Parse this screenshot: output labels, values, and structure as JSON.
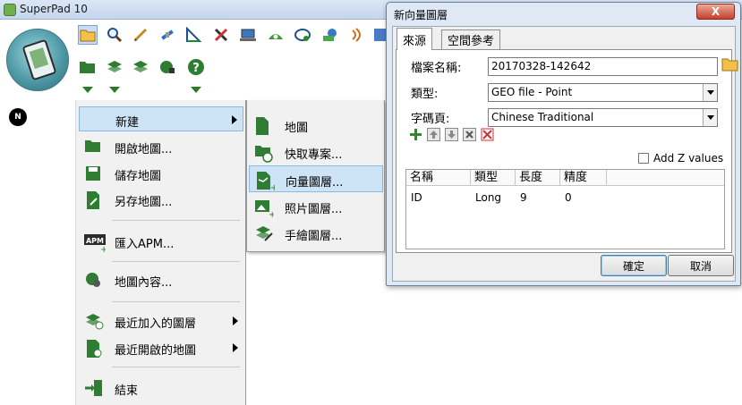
{
  "app": {
    "title": "SuperPad 10"
  },
  "toolbar": {
    "row1_icons": [
      "open-folder-icon",
      "zoom-icon",
      "pen-icon",
      "satellite-icon",
      "measure-icon",
      "tools-icon",
      "laptop-icon",
      "eye-map-icon",
      "cloud-sync-icon",
      "layers-globe-icon",
      "signal-icon",
      "grid-icon"
    ],
    "row2_icons": [
      "open-folder-icon",
      "layers-add-icon",
      "layers-icon",
      "globe-lock-icon",
      "help-icon"
    ]
  },
  "north_label": "N",
  "main_menu": {
    "items": [
      {
        "label": "新建",
        "icon": "new-icon",
        "submenu": true,
        "highlighted": true
      },
      {
        "label": "開啟地圖...",
        "icon": "folder-open-icon"
      },
      {
        "label": "儲存地圖",
        "icon": "save-icon"
      },
      {
        "label": "另存地圖...",
        "icon": "save-as-icon"
      },
      {
        "label": "匯入APM...",
        "icon": "apm-import-icon"
      },
      {
        "label": "地圖內容...",
        "icon": "map-properties-icon"
      },
      {
        "label": "最近加入的圖層",
        "icon": "recent-layers-icon",
        "submenu": true
      },
      {
        "label": "最近開啟的地圖",
        "icon": "recent-maps-icon",
        "submenu": true
      },
      {
        "label": "結束",
        "icon": "exit-icon"
      }
    ],
    "apm_icon_text": "APM"
  },
  "sub_menu": {
    "items": [
      {
        "label": "地圖",
        "icon": "map-doc-icon"
      },
      {
        "label": "快取專案...",
        "icon": "cache-project-icon"
      },
      {
        "label": "向量圖層...",
        "icon": "vector-layer-icon",
        "highlighted": true
      },
      {
        "label": "照片圖層...",
        "icon": "photo-layer-icon"
      },
      {
        "label": "手繪圖層...",
        "icon": "sketch-layer-icon"
      }
    ]
  },
  "dialog": {
    "title": "新向量圖層",
    "close_symbol": "X",
    "tabs": [
      "來源",
      "空間參考"
    ],
    "file_name_label": "檔案名稱:",
    "file_name_value": "20170328-142642",
    "type_label": "類型:",
    "type_value": "GEO file - Point",
    "codepage_label": "字碼頁:",
    "codepage_value": "Chinese Traditional",
    "add_z_label": "Add Z values",
    "add_z_checked": false,
    "grid": {
      "headers": [
        "名稱",
        "類型",
        "長度",
        "精度"
      ],
      "rows": [
        [
          "ID",
          "Long",
          "9",
          "0"
        ]
      ]
    },
    "ok_label": "確定",
    "cancel_label": "取消"
  },
  "colors": {
    "menu_highlight": "#cde4f7",
    "menu_bg": "#f1f1f1",
    "dialog_frame": "#dfe9f5",
    "close_red": "#c4402a",
    "icon_green": "#2e7d32"
  }
}
